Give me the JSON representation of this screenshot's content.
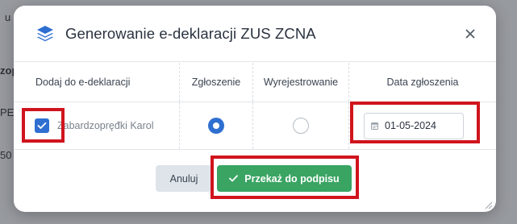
{
  "background": {
    "fragments": [
      "u ro",
      "zop",
      "PE",
      "50"
    ]
  },
  "modal": {
    "title": "Generowanie e-deklaracji ZUS ZCNA",
    "close_icon": "close-icon",
    "title_icon": "layers-icon"
  },
  "table": {
    "headers": {
      "add": "Dodaj do e-deklaracji",
      "registration": "Zgłoszenie",
      "deregistration": "Wyrejestrowanie",
      "date": "Data zgłoszenia"
    },
    "row": {
      "checked": true,
      "name": "Zabardzopręđki Karol",
      "registration_selected": true,
      "deregistration_selected": false,
      "date": "01-05-2024"
    }
  },
  "footer": {
    "cancel_label": "Anuluj",
    "submit_label": "Przekaż do podpisu"
  },
  "colors": {
    "accent": "#2f6fd1",
    "submit": "#3aa463",
    "highlight": "#d0141d"
  }
}
